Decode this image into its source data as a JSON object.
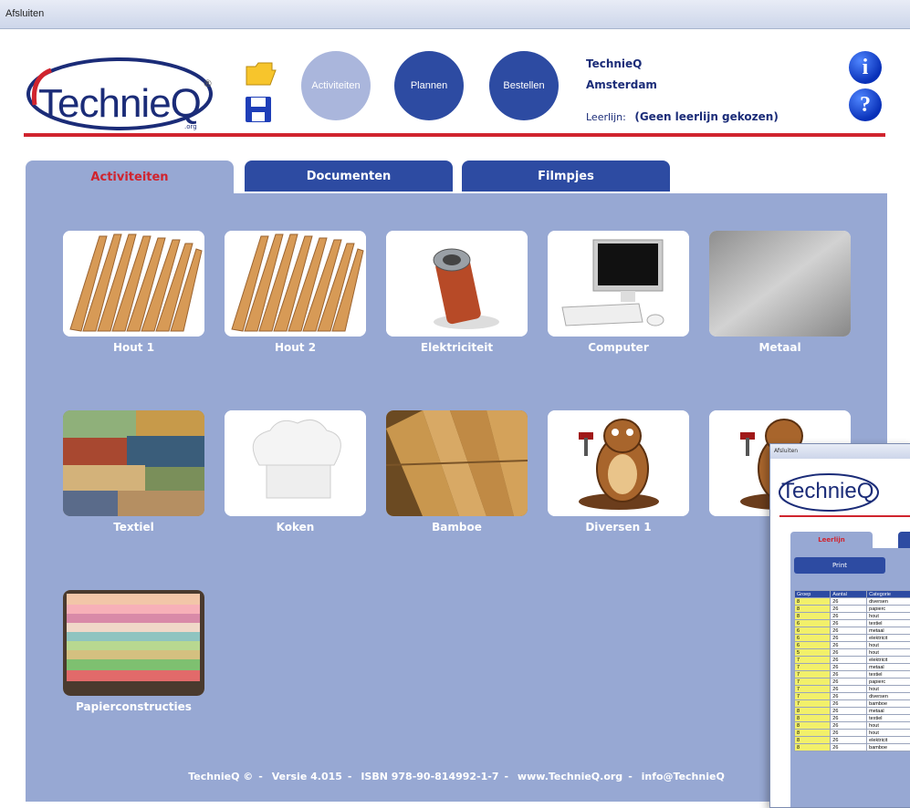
{
  "menubar": {
    "close_label": "Afsluiten"
  },
  "header": {
    "logo_text": "TechnieQ",
    "logo_org": ".org",
    "buttons": {
      "activiteiten": "Activiteiten",
      "plannen": "Plannen",
      "bestellen": "Bestellen"
    },
    "school_name": "TechnieQ",
    "school_city": "Amsterdam",
    "leerlijn_label": "Leerlijn:",
    "leerlijn_value": "(Geen leerlijn gekozen)",
    "info_symbol": "i",
    "help_symbol": "?"
  },
  "tabs": [
    "Activiteiten",
    "Documenten",
    "Filmpjes"
  ],
  "tiles": [
    {
      "label": "Hout 1",
      "icon": "wood-sticks-icon"
    },
    {
      "label": "Hout 2",
      "icon": "wood-sticks-icon"
    },
    {
      "label": "Elektriciteit",
      "icon": "battery-icon"
    },
    {
      "label": "Computer",
      "icon": "computer-icon"
    },
    {
      "label": "Metaal",
      "icon": "metal-sheet-icon"
    },
    {
      "label": "Textiel",
      "icon": "fabric-icon"
    },
    {
      "label": "Koken",
      "icon": "chef-hat-icon"
    },
    {
      "label": "Bamboe",
      "icon": "bamboo-icon"
    },
    {
      "label": "Diversen 1",
      "icon": "beaver-icon"
    },
    {
      "label": "Di",
      "icon": "beaver-icon"
    },
    {
      "label": "Papierconstructies",
      "icon": "paper-stack-icon"
    }
  ],
  "footer": {
    "copyright": "TechnieQ ©",
    "version": "Versie 4.015",
    "isbn": "ISBN 978-90-814992-1-7",
    "website": "www.TechnieQ.org",
    "email": "info@TechnieQ"
  },
  "overlay": {
    "logo_text": "TechnieQ",
    "tab_label": "Leerlijn",
    "button_label": "Print",
    "table_header": [
      "Groep",
      "Aantal",
      "Categorie"
    ],
    "rows": [
      [
        "8",
        "26",
        "diversen"
      ],
      [
        "8",
        "26",
        "papierc"
      ],
      [
        "8",
        "26",
        "hout"
      ],
      [
        "6",
        "26",
        "textiel"
      ],
      [
        "6",
        "26",
        "metaal"
      ],
      [
        "6",
        "26",
        "elektricit"
      ],
      [
        "6",
        "26",
        "hout"
      ],
      [
        "5",
        "26",
        "hout"
      ],
      [
        "7",
        "26",
        "elektricit"
      ],
      [
        "7",
        "26",
        "metaal"
      ],
      [
        "7",
        "26",
        "textiel"
      ],
      [
        "7",
        "26",
        "papierc"
      ],
      [
        "7",
        "26",
        "hout"
      ],
      [
        "7",
        "26",
        "diversen"
      ],
      [
        "7",
        "26",
        "bamboe"
      ],
      [
        "8",
        "26",
        "metaal"
      ],
      [
        "8",
        "26",
        "textiel"
      ],
      [
        "8",
        "26",
        "hout"
      ],
      [
        "8",
        "26",
        "hout"
      ],
      [
        "8",
        "26",
        "elektricit"
      ],
      [
        "8",
        "26",
        "bamboe"
      ]
    ]
  },
  "colors": {
    "accent_red": "#d0242e",
    "navy": "#2d4ba2",
    "panel": "#97a8d3"
  }
}
